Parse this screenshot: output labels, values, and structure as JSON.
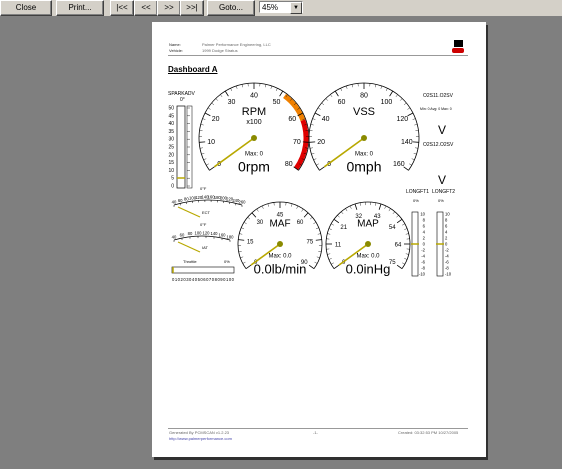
{
  "toolbar": {
    "close": "Close",
    "print": "Print...",
    "first": "|<<",
    "prev": "<<",
    "next": ">>",
    "last": ">>|",
    "goto": "Goto...",
    "zoom": "45%"
  },
  "header": {
    "name_label": "Name:",
    "name_value": "Palmer Performance Engineering, LLC",
    "vehicle_label": "Vehicle:",
    "vehicle_value": "1999 Dodge Stratus"
  },
  "title": "Dashboard A",
  "gauges": {
    "spark": {
      "label": "SPARKADV",
      "unit": "0°",
      "ticks": [
        "50",
        "45",
        "40",
        "35",
        "30",
        "25",
        "20",
        "15",
        "10",
        "5",
        "0"
      ],
      "value": 0
    },
    "rpm": {
      "label": "RPM",
      "sub": "x100",
      "ticks": [
        "0",
        "10",
        "20",
        "30",
        "40",
        "50",
        "60",
        "70",
        "80"
      ],
      "max": "Max: 0",
      "reading": "0rpm",
      "value": 0
    },
    "vss": {
      "label": "VSS",
      "ticks": [
        "0",
        "20",
        "40",
        "60",
        "80",
        "100",
        "120",
        "140",
        "160"
      ],
      "max": "Max: 0",
      "reading": "0mph",
      "value": 0
    },
    "o2s11": {
      "label": "O2S11.O2SV",
      "minmax": "Min: 0  Avg: 0  Max: 0",
      "unit": "V"
    },
    "o2s12": {
      "label": "O2S12.O2SV",
      "unit": "V"
    },
    "ect": {
      "label": "ECT",
      "unit": "0°F",
      "ticks": [
        "40",
        "60",
        "80",
        "100",
        "120",
        "140",
        "160",
        "180",
        "200",
        "220",
        "240",
        "260"
      ],
      "value": 0
    },
    "iat": {
      "label": "IAT",
      "unit": "0°F",
      "ticks": [
        "40",
        "60",
        "80",
        "100",
        "120",
        "140",
        "160",
        "180"
      ],
      "value": 0
    },
    "maf": {
      "label": "MAF",
      "ticks": [
        "0",
        "15",
        "30",
        "45",
        "60",
        "75",
        "90"
      ],
      "max": "Max: 0.0",
      "reading": "0.0lb/min",
      "value": 0
    },
    "map": {
      "label": "MAP",
      "ticks": [
        "0",
        "11",
        "21",
        "32",
        "43",
        "54",
        "64",
        "75"
      ],
      "max": "Max: 0.0",
      "reading": "0.0inHg",
      "value": 0
    },
    "ltft1": {
      "label": "LONGFT1",
      "value_text": "0%",
      "ticks": [
        "10",
        "8",
        "6",
        "4",
        "2",
        "0",
        "-2",
        "-4",
        "-6",
        "-8",
        "-10"
      ]
    },
    "ltft2": {
      "label": "LONGFT2",
      "value_text": "0%",
      "ticks": [
        "10",
        "8",
        "6",
        "4",
        "2",
        "0",
        "-2",
        "-4",
        "-6",
        "-8",
        "-10"
      ]
    },
    "throttle": {
      "label": "Throttle",
      "value_text": "0%",
      "ticks": "0102030405060708090100"
    }
  },
  "footer": {
    "generated": "Generated By PCMSCAN v1.2.23",
    "url": "http://www.palmerperformance.com",
    "page": "-1-",
    "created": "Created: 03:32:53 PM 10/27/2005"
  },
  "colors": {
    "needle": "#b8a800",
    "redline": "#e00000",
    "warn": "#f08000"
  }
}
